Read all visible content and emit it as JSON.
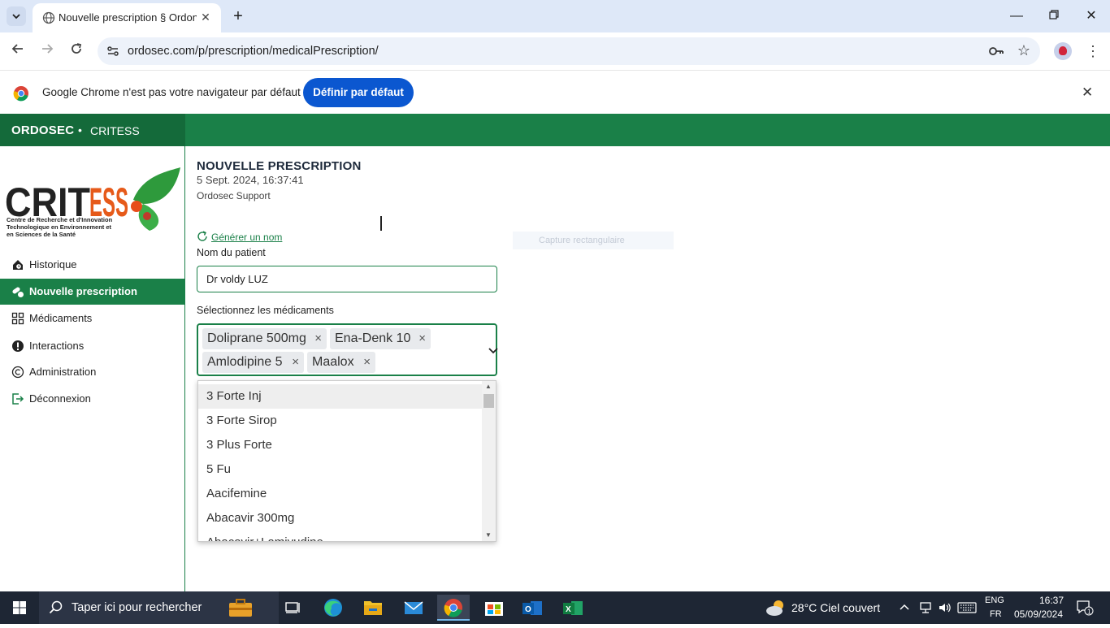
{
  "browser": {
    "tab_title": "Nouvelle prescription § Ordonanc",
    "url": "ordosec.com/p/prescription/medicalPrescription/",
    "infobar_message": "Google Chrome n'est pas votre navigateur par défaut",
    "infobar_button": "Définir par défaut"
  },
  "app": {
    "brand": "ORDOSEC",
    "separator": "•",
    "organization": "CRITESS",
    "logo_text": "CRITESS",
    "logo_subtitle_1": "Centre de Recherche et d'Innovation",
    "logo_subtitle_2": "Technologique en Environnement et",
    "logo_subtitle_3": "en Sciences de la Santé"
  },
  "sidebar": {
    "items": [
      {
        "label": "Historique",
        "icon": "history-icon"
      },
      {
        "label": "Nouvelle prescription",
        "icon": "prescription-icon",
        "active": true
      },
      {
        "label": "Médicaments",
        "icon": "grid-icon"
      },
      {
        "label": "Interactions",
        "icon": "alert-icon"
      },
      {
        "label": "Administration",
        "icon": "copyright-icon"
      },
      {
        "label": "Déconnexion",
        "icon": "logout-icon"
      }
    ]
  },
  "main": {
    "title": "NOUVELLE PRESCRIPTION",
    "date": "5 Sept. 2024, 16:37:41",
    "author": "Ordosec Support",
    "generate_link": "Générer un nom",
    "patient_label": "Nom du patient",
    "patient_value": "Dr voldy LUZ",
    "meds_label": "Sélectionnez les médicaments",
    "selected_meds": [
      "Doliprane 500mg",
      "Ena-Denk 10",
      "Amlodipine 5",
      "Maalox"
    ],
    "dropdown_options": [
      "3 Forte Inj",
      "3 Forte Sirop",
      "3 Plus Forte",
      "5 Fu",
      "Aacifemine",
      "Abacavir 300mg",
      "Abacavir+Lamivudine"
    ],
    "ghost_overlay": "Capture rectangulaire"
  },
  "taskbar": {
    "search_placeholder": "Taper ici pour rechercher",
    "weather": "28°C  Ciel couvert",
    "lang_top": "ENG",
    "lang_bottom": "FR",
    "time": "16:37",
    "date": "05/09/2024",
    "notification_count": "1"
  }
}
